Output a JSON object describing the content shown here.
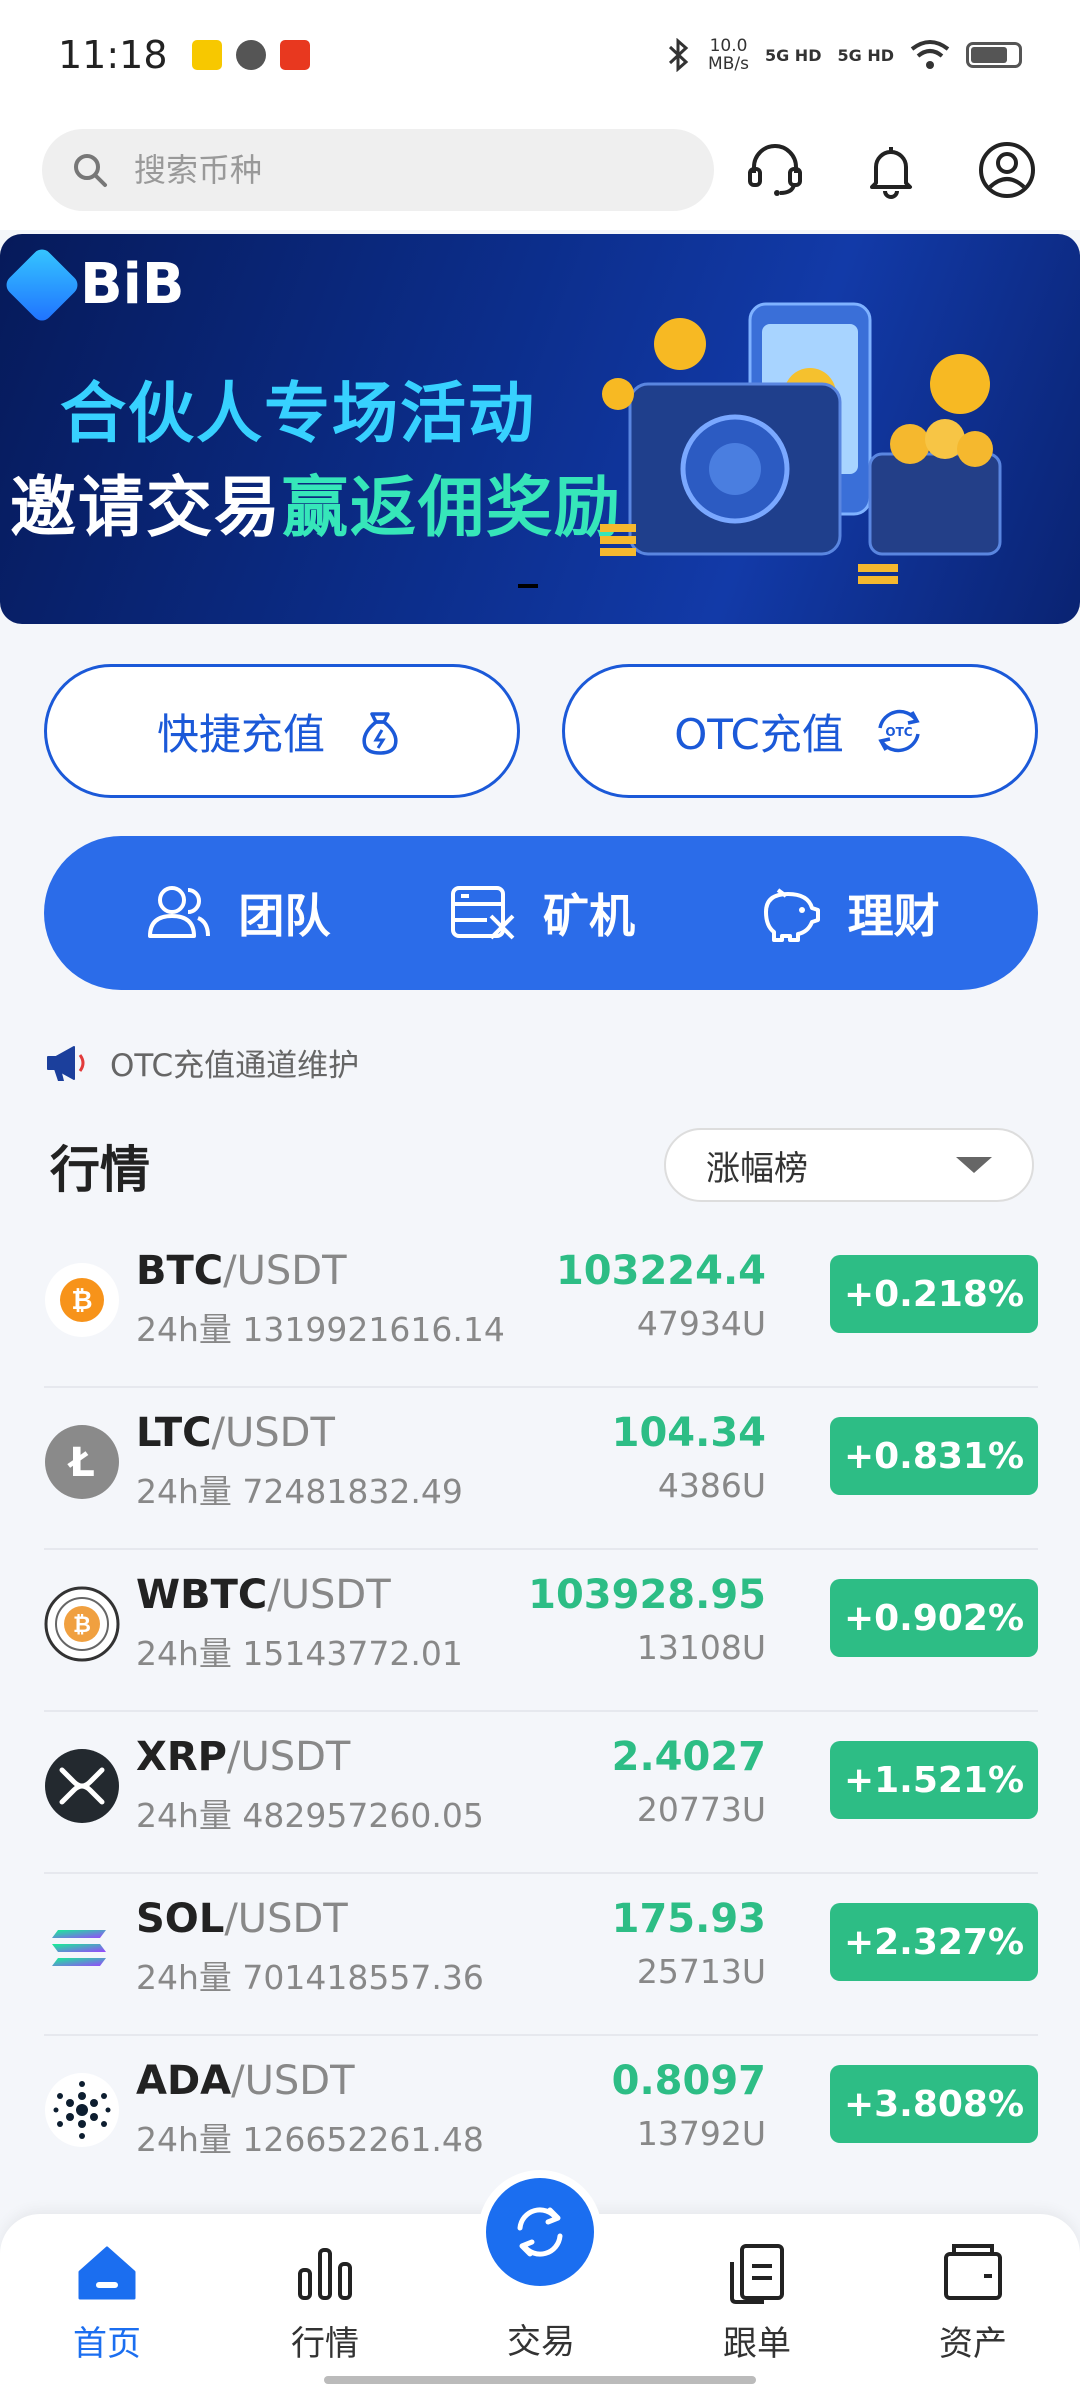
{
  "status_bar": {
    "time": "11:18",
    "net_speed_value": "10.0",
    "net_speed_unit": "MB/s",
    "signal1": "5G HD",
    "signal2": "5G HD"
  },
  "header": {
    "search_placeholder": "搜索币种",
    "icons": [
      "headset-icon",
      "bell-icon",
      "user-icon"
    ]
  },
  "banner": {
    "brand": "BiB",
    "line1": "合伙人专场活动",
    "line2_part1": "邀请交易",
    "line2_part2": "赢返佣奖励"
  },
  "deposit": {
    "quick_label": "快捷充值",
    "otc_label": "OTC充值"
  },
  "features": [
    {
      "label": "团队",
      "icon": "team-icon"
    },
    {
      "label": "矿机",
      "icon": "miner-icon"
    },
    {
      "label": "理财",
      "icon": "piggy-bank-icon"
    }
  ],
  "notice": {
    "text": "OTC充值通道维护"
  },
  "market": {
    "title": "行情",
    "sort_selected": "涨幅榜",
    "rows": [
      {
        "base": "BTC",
        "quote": "/USDT",
        "volume": "24h量 1319921616.14",
        "price": "103224.4",
        "sub": "47934U",
        "change": "+0.218%",
        "icon_color": "#f7931a"
      },
      {
        "base": "LTC",
        "quote": "/USDT",
        "volume": "24h量 72481832.49",
        "price": "104.34",
        "sub": "4386U",
        "change": "+0.831%",
        "icon_color": "#8a8a8a"
      },
      {
        "base": "WBTC",
        "quote": "/USDT",
        "volume": "24h量 15143772.01",
        "price": "103928.95",
        "sub": "13108U",
        "change": "+0.902%",
        "icon_color": "#f0a040"
      },
      {
        "base": "XRP",
        "quote": "/USDT",
        "volume": "24h量 482957260.05",
        "price": "2.4027",
        "sub": "20773U",
        "change": "+1.521%",
        "icon_color": "#23292f"
      },
      {
        "base": "SOL",
        "quote": "/USDT",
        "volume": "24h量 701418557.36",
        "price": "175.93",
        "sub": "25713U",
        "change": "+2.327%",
        "icon_color": "#9a4cf0"
      },
      {
        "base": "ADA",
        "quote": "/USDT",
        "volume": "24h量 126652261.48",
        "price": "0.8097",
        "sub": "13792U",
        "change": "+3.808%",
        "icon_color": "#0d1e30"
      }
    ]
  },
  "nav": {
    "home": "首页",
    "market": "行情",
    "trade": "交易",
    "copy": "跟单",
    "assets": "资产"
  },
  "colors": {
    "accent": "#1b6ef0",
    "up_green": "#2dbd85",
    "feature_bar": "#2b6ce9"
  }
}
